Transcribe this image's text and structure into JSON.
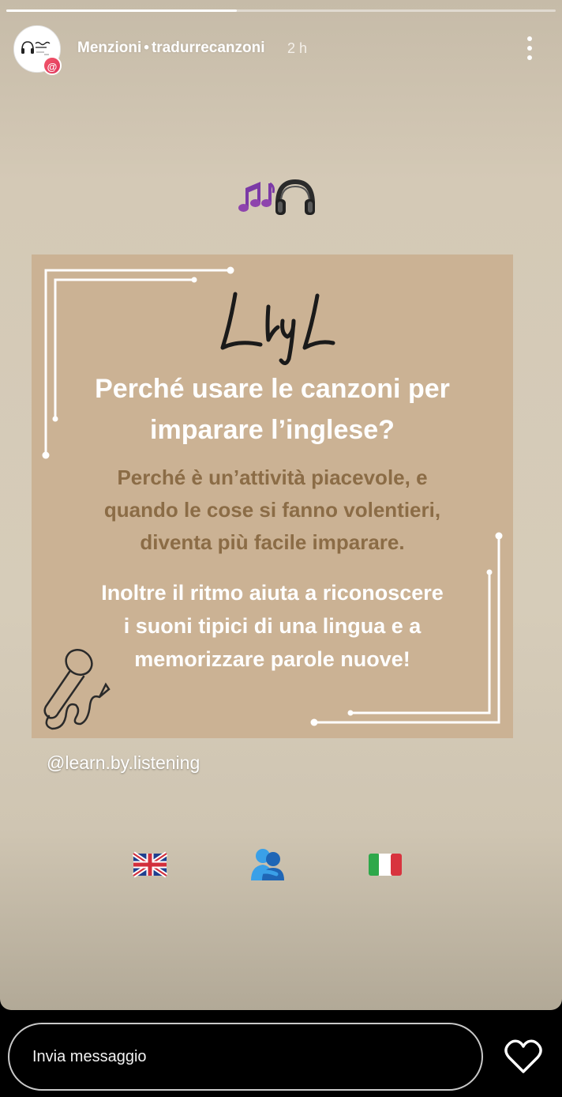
{
  "story": {
    "progress_fraction": 0.42,
    "header": {
      "title": "Menzioni",
      "separator": "•",
      "account": "tradurrecanzoni",
      "time": "2 h",
      "badge_symbol": "@"
    },
    "emoji_row": [
      "music-notes-icon",
      "headphones-icon"
    ],
    "card": {
      "logo": "L by L",
      "heading": [
        "Perché usare le canzoni per",
        "imparare l’inglese?"
      ],
      "body": [
        "Perché è un’attività piacevole, e",
        "quando le cose si fanno volentieri,",
        "diventa più facile imparare."
      ],
      "body_white": [
        "Inoltre il ritmo aiuta  a riconoscere",
        "i suoni tipici di una lingua e a",
        "memorizzare  parole nuove!"
      ]
    },
    "mention_tag": "@learn.by.listening",
    "flags": [
      "uk-flag-icon",
      "people-hugging-icon",
      "italy-flag-icon"
    ]
  },
  "footer": {
    "message_placeholder": "Invia messaggio"
  },
  "colors": {
    "story_bg": "#d4c9b6",
    "card_bg": "#cbb294",
    "card_body_text": "#8b6c46",
    "badge": "#e8455e"
  }
}
